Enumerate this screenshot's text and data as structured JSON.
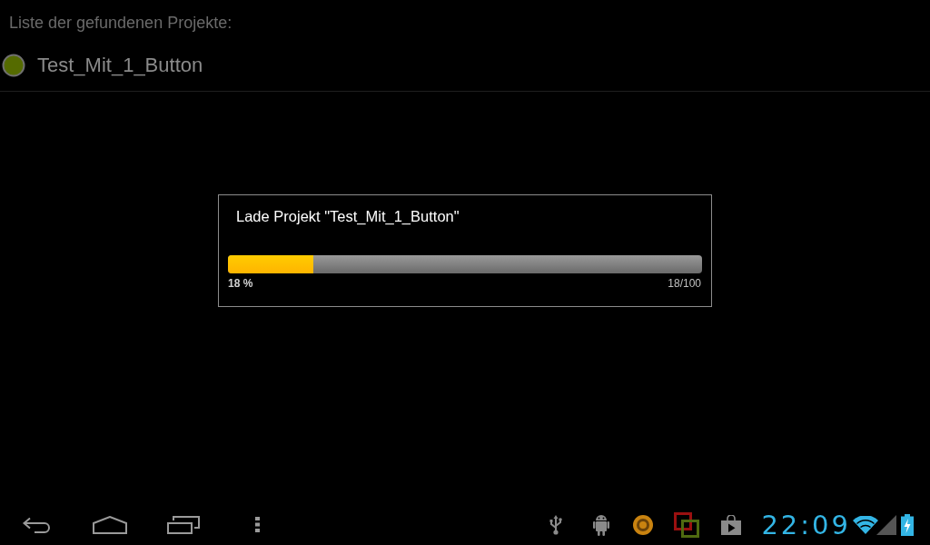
{
  "header": {
    "title": "Liste der gefundenen Projekte:"
  },
  "projects": [
    {
      "name": "Test_Mit_1_Button",
      "color": "#556b00"
    }
  ],
  "dialog": {
    "title": "Lade Projekt \"Test_Mit_1_Button\"",
    "progress": {
      "level": 0.18,
      "percent": "18 %",
      "count": "18/100"
    }
  },
  "system_bar": {
    "clock": "22:09"
  }
}
